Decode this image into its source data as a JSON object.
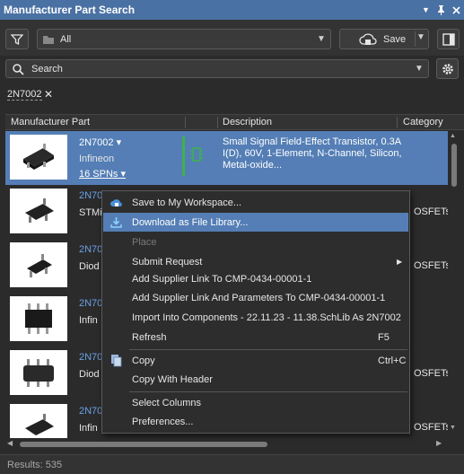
{
  "window": {
    "title": "Manufacturer Part Search"
  },
  "toolbar": {
    "filter_value": "All",
    "save_label": "Save"
  },
  "search": {
    "placeholder": "Search"
  },
  "filter_tag": "2N7002",
  "columns": {
    "part": "Manufacturer Part",
    "description": "Description",
    "category": "Category"
  },
  "rows": [
    {
      "part": "2N7002",
      "manufacturer": "Infineon",
      "spns": "16 SPNs",
      "description": "Small Signal Field-Effect Transistor, 0.3A I(D), 60V, 1-Element, N-Channel, Silicon, Metal-oxide...",
      "category": ""
    },
    {
      "part": "2N70",
      "manufacturer": "STMi",
      "category": "OSFETs"
    },
    {
      "part": "2N70",
      "manufacturer": "Diod",
      "category": "OSFETs"
    },
    {
      "part": "2N70",
      "manufacturer": "Infin",
      "category": ""
    },
    {
      "part": "2N70",
      "manufacturer": "Diod",
      "category": "OSFETs"
    },
    {
      "part": "2N70",
      "manufacturer": "Infin",
      "category": "OSFETs"
    }
  ],
  "context_menu": {
    "items": [
      {
        "label": "Save to My Workspace...",
        "shortcut": "",
        "icon": "workspace-cloud-icon"
      },
      {
        "label": "Download as File Library...",
        "shortcut": "",
        "icon": "download-icon",
        "highlighted": true
      },
      {
        "label": "Place",
        "shortcut": "",
        "disabled": true
      },
      {
        "label": "Submit Request",
        "shortcut": "",
        "submenu": true
      },
      {
        "label": "Add Supplier Link To CMP-0434-00001-1",
        "shortcut": ""
      },
      {
        "label": "Add Supplier Link And Parameters To CMP-0434-00001-1",
        "shortcut": ""
      },
      {
        "label": "Import Into Components - 22.11.23 - 11.38.SchLib As 2N7002",
        "shortcut": ""
      },
      {
        "label": "Refresh",
        "shortcut": "F5"
      },
      {
        "label": "Copy",
        "shortcut": "Ctrl+C",
        "icon": "copy-icon"
      },
      {
        "label": "Copy With Header",
        "shortcut": ""
      },
      {
        "label": "Select Columns",
        "shortcut": ""
      },
      {
        "label": "Preferences...",
        "shortcut": ""
      }
    ]
  },
  "status": {
    "results": "Results: 535"
  },
  "colors": {
    "titlebar": "#4a71a3",
    "selection": "#547eb5",
    "link": "#6aa1e6",
    "accent_green": "#3fb24a"
  }
}
